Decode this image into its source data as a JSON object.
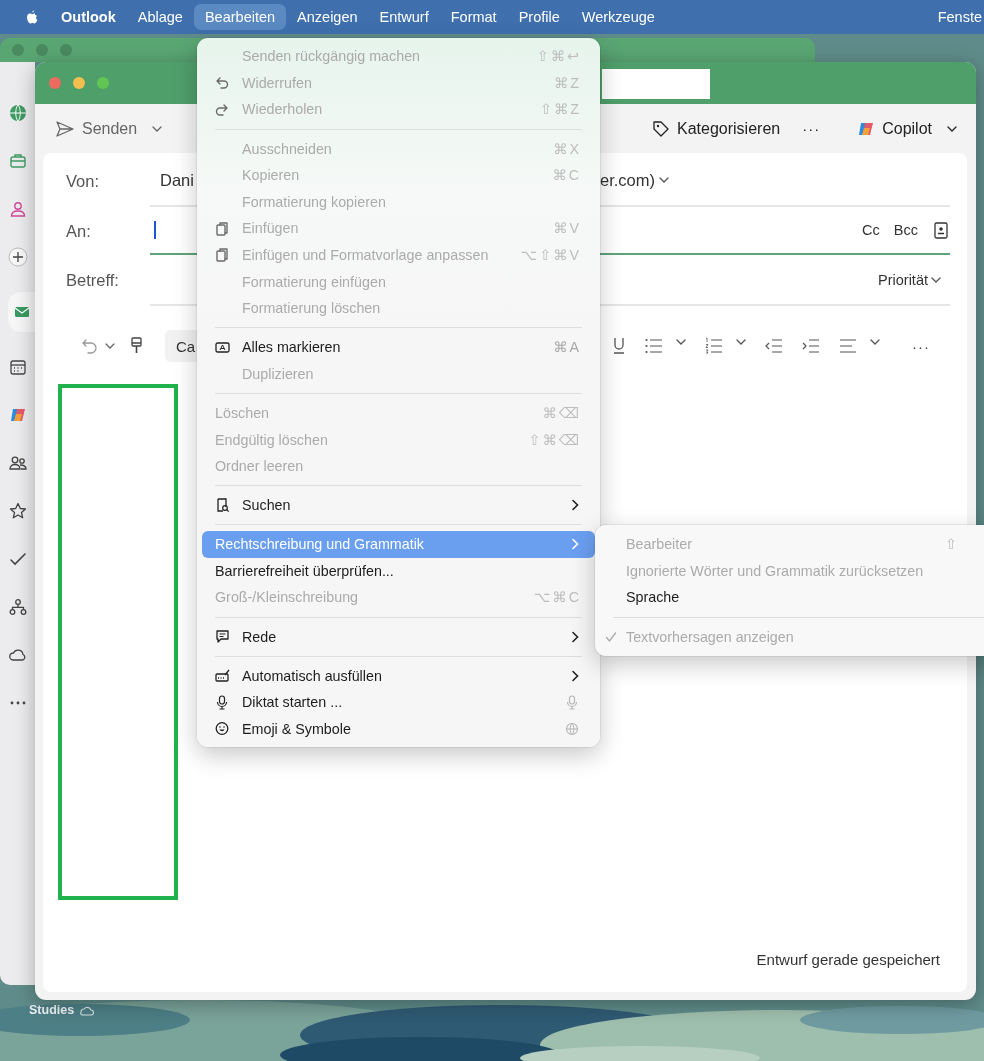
{
  "menu_bar": {
    "items": [
      {
        "label": "Outlook",
        "kind": "app",
        "selected": false
      },
      {
        "label": "Ablage",
        "kind": "menu",
        "selected": false
      },
      {
        "label": "Bearbeiten",
        "kind": "menu",
        "selected": true
      },
      {
        "label": "Anzeigen",
        "kind": "menu",
        "selected": false
      },
      {
        "label": "Entwurf",
        "kind": "menu",
        "selected": false
      },
      {
        "label": "Format",
        "kind": "menu",
        "selected": false
      },
      {
        "label": "Profile",
        "kind": "menu",
        "selected": false
      },
      {
        "label": "Werkzeuge",
        "kind": "menu",
        "selected": false
      },
      {
        "label": "Fenste",
        "kind": "edge",
        "selected": false
      }
    ]
  },
  "back_window": {
    "sidebar": [
      {
        "kind": "globe",
        "selected": false
      },
      {
        "kind": "briefcase",
        "selected": false
      },
      {
        "kind": "person",
        "selected": false
      },
      {
        "kind": "add",
        "selected": false
      },
      {
        "kind": "mail",
        "selected": true
      },
      {
        "kind": "calendar",
        "selected": false
      },
      {
        "kind": "copilot",
        "selected": false
      },
      {
        "kind": "people",
        "selected": false
      },
      {
        "kind": "star",
        "selected": false
      },
      {
        "kind": "check",
        "selected": false
      },
      {
        "kind": "org",
        "selected": false
      },
      {
        "kind": "cloud",
        "selected": false
      },
      {
        "kind": "more",
        "selected": false
      }
    ]
  },
  "compose": {
    "toolbar": {
      "send": "Senden",
      "categorize": "Kategorisieren",
      "more": "···",
      "copilot": "Copilot"
    },
    "from": {
      "label": "Von:",
      "value_start": "Dani",
      "value_end": "er.com)"
    },
    "to": {
      "label": "An:",
      "cc": "Cc",
      "bcc": "Bcc"
    },
    "subject": {
      "label": "Betreff:",
      "priority": "Priorität"
    },
    "format_toolbar": {
      "font": "Ca",
      "more": "···"
    },
    "status": "Entwurf gerade gespeichert"
  },
  "edit_menu": [
    {
      "kind": "plain",
      "label": "Senden rückgängig machen",
      "shortcut": "⇧⌘↩",
      "disabled": true,
      "submenu": false,
      "selected": false
    },
    {
      "kind": "undo",
      "label": "Widerrufen",
      "shortcut": "⌘Z",
      "disabled": true,
      "submenu": false,
      "selected": false
    },
    {
      "kind": "redo",
      "label": "Wiederholen",
      "shortcut": "⇧⌘Z",
      "disabled": true,
      "submenu": false,
      "selected": false
    },
    {
      "kind": "separator"
    },
    {
      "kind": "plain",
      "label": "Ausschneiden",
      "shortcut": "⌘X",
      "disabled": true,
      "submenu": false,
      "selected": false
    },
    {
      "kind": "plain",
      "label": "Kopieren",
      "shortcut": "⌘C",
      "disabled": true,
      "submenu": false,
      "selected": false
    },
    {
      "kind": "plain",
      "label": "Formatierung kopieren",
      "disabled": true,
      "submenu": false,
      "selected": false
    },
    {
      "kind": "paste",
      "label": "Einfügen",
      "shortcut": "⌘V",
      "disabled": true,
      "submenu": false,
      "selected": false
    },
    {
      "kind": "paste",
      "label": "Einfügen und Formatvorlage anpassen",
      "shortcut": "⌥⇧⌘V",
      "disabled": true,
      "submenu": false,
      "selected": false
    },
    {
      "kind": "plain",
      "label": "Formatierung einfügen",
      "disabled": true,
      "submenu": false,
      "selected": false
    },
    {
      "kind": "plain",
      "label": "Formatierung löschen",
      "disabled": true,
      "submenu": false,
      "selected": false
    },
    {
      "kind": "separator"
    },
    {
      "kind": "select",
      "label": "Alles markieren",
      "shortcut": "⌘A",
      "disabled": false,
      "submenu": false,
      "selected": false
    },
    {
      "kind": "plain",
      "label": "Duplizieren",
      "disabled": true,
      "submenu": false,
      "selected": false
    },
    {
      "kind": "separator"
    },
    {
      "kind": "flush",
      "label": "Löschen",
      "shortcut": "⌘⌫",
      "disabled": true,
      "submenu": false,
      "selected": false
    },
    {
      "kind": "flush",
      "label": "Endgültig löschen",
      "shortcut": "⇧⌘⌫",
      "disabled": true,
      "submenu": false,
      "selected": false
    },
    {
      "kind": "flush",
      "label": "Ordner leeren",
      "disabled": true,
      "submenu": false,
      "selected": false
    },
    {
      "kind": "separator"
    },
    {
      "kind": "find",
      "label": "Suchen",
      "disabled": false,
      "submenu": true,
      "selected": false
    },
    {
      "kind": "separator"
    },
    {
      "kind": "flush",
      "label": "Rechtschreibung und Grammatik",
      "disabled": false,
      "submenu": true,
      "selected": true
    },
    {
      "kind": "flush",
      "label": "Barrierefreiheit überprüfen...",
      "disabled": false,
      "submenu": false,
      "selected": false
    },
    {
      "kind": "flush",
      "label": "Groß-/Kleinschreibung",
      "shortcut": "⌥⌘C",
      "disabled": true,
      "submenu": false,
      "selected": false
    },
    {
      "kind": "separator"
    },
    {
      "kind": "speech",
      "label": "Rede",
      "disabled": false,
      "submenu": true,
      "selected": false
    },
    {
      "kind": "separator"
    },
    {
      "kind": "autofill",
      "label": "Automatisch ausfüllen",
      "disabled": false,
      "submenu": true,
      "selected": false
    },
    {
      "kind": "dictate",
      "label": "Diktat starten ...",
      "disabled": false,
      "submenu": false,
      "selected": false
    },
    {
      "kind": "emoji",
      "label": "Emoji & Symbole",
      "disabled": false,
      "submenu": false,
      "selected": false
    }
  ],
  "spelling_submenu": [
    {
      "kind": "item",
      "label": "Bearbeiter",
      "shortcut": "⇧",
      "disabled": true,
      "checked": false
    },
    {
      "kind": "item",
      "label": "Ignorierte Wörter und Grammatik zurücksetzen",
      "disabled": true,
      "checked": false
    },
    {
      "kind": "item",
      "label": "Sprache",
      "disabled": false,
      "checked": false
    },
    {
      "kind": "separator"
    },
    {
      "kind": "item",
      "label": "Textvorhersagen anzeigen",
      "disabled": true,
      "checked": true
    }
  ],
  "desktop": {
    "folder": "Studies"
  }
}
